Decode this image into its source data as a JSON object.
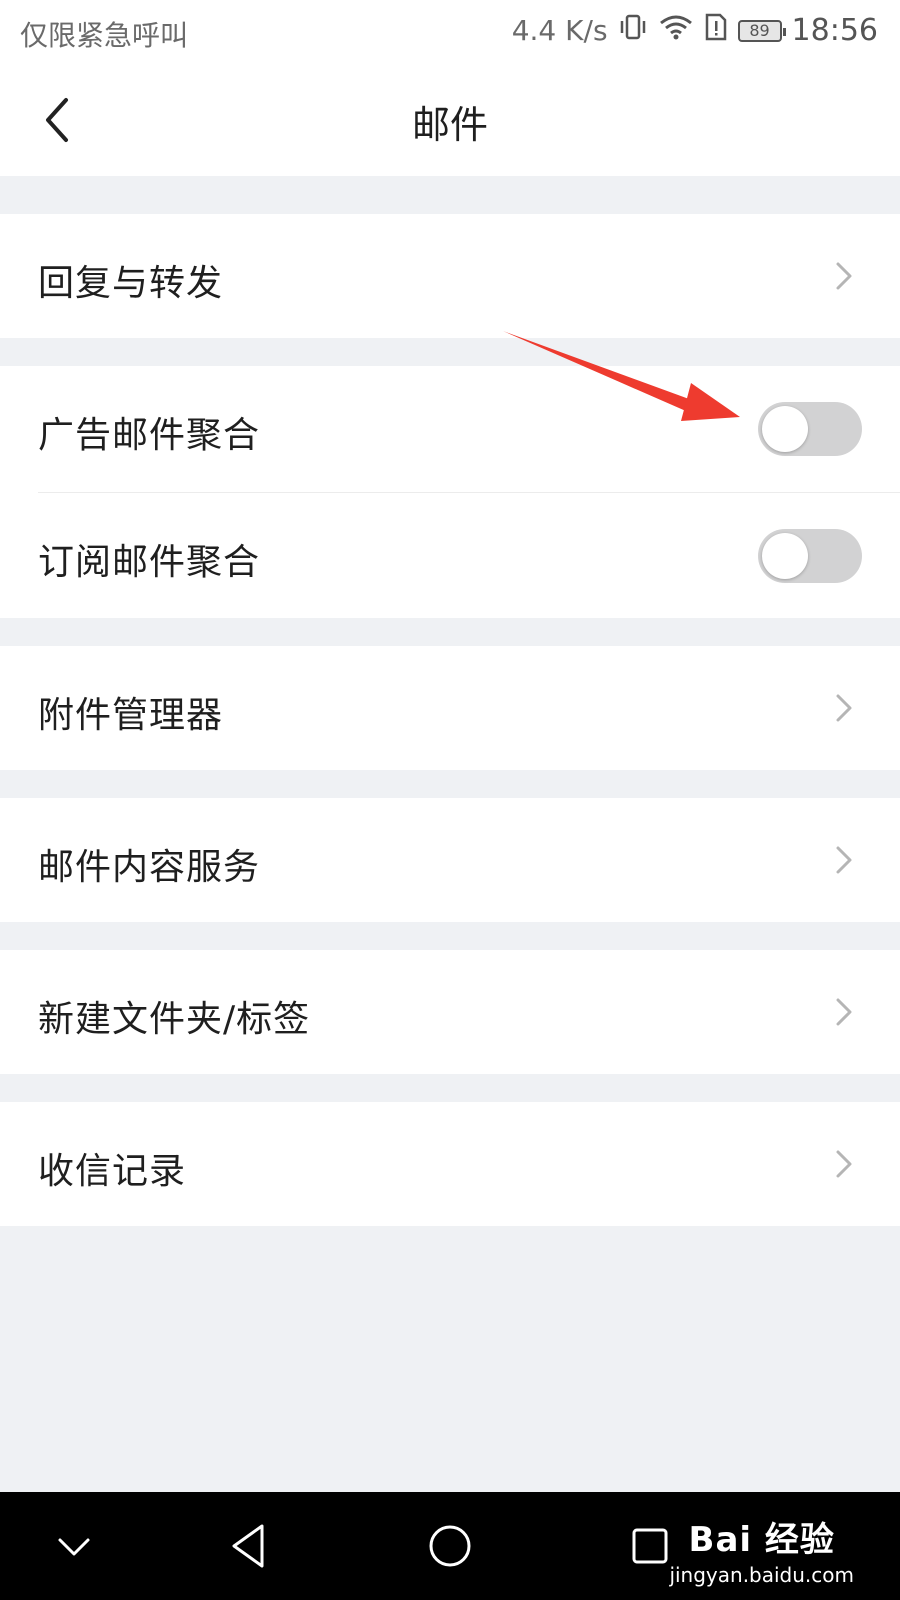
{
  "status_bar": {
    "carrier": "仅限紧急呼叫",
    "net_speed": "4.4 K/s",
    "battery": "89",
    "time": "18:56",
    "icons": [
      "vibrate-icon",
      "wifi-icon",
      "sim-alert-icon",
      "battery-icon"
    ]
  },
  "nav": {
    "back_icon": "chevron-left-icon",
    "title": "邮件"
  },
  "settings": {
    "reply_forward": "回复与转发",
    "ad_aggregate": {
      "label": "广告邮件聚合",
      "enabled": false
    },
    "subscription_aggregate": {
      "label": "订阅邮件聚合",
      "enabled": false
    },
    "attachment_manager": "附件管理器",
    "content_service": "邮件内容服务",
    "new_folder_tag": "新建文件夹/标签",
    "receive_log": "收信记录"
  },
  "colors": {
    "background": "#eff1f4",
    "toggle_off": "#d2d2d3",
    "annotation_arrow": "#ee3b2f"
  },
  "system_nav": {
    "buttons": [
      "collapse-icon",
      "back-triangle-icon",
      "home-circle-icon",
      "recents-square-icon"
    ]
  },
  "watermark": {
    "main": "Bai 经验",
    "sub": "jingyan.baidu.com"
  }
}
